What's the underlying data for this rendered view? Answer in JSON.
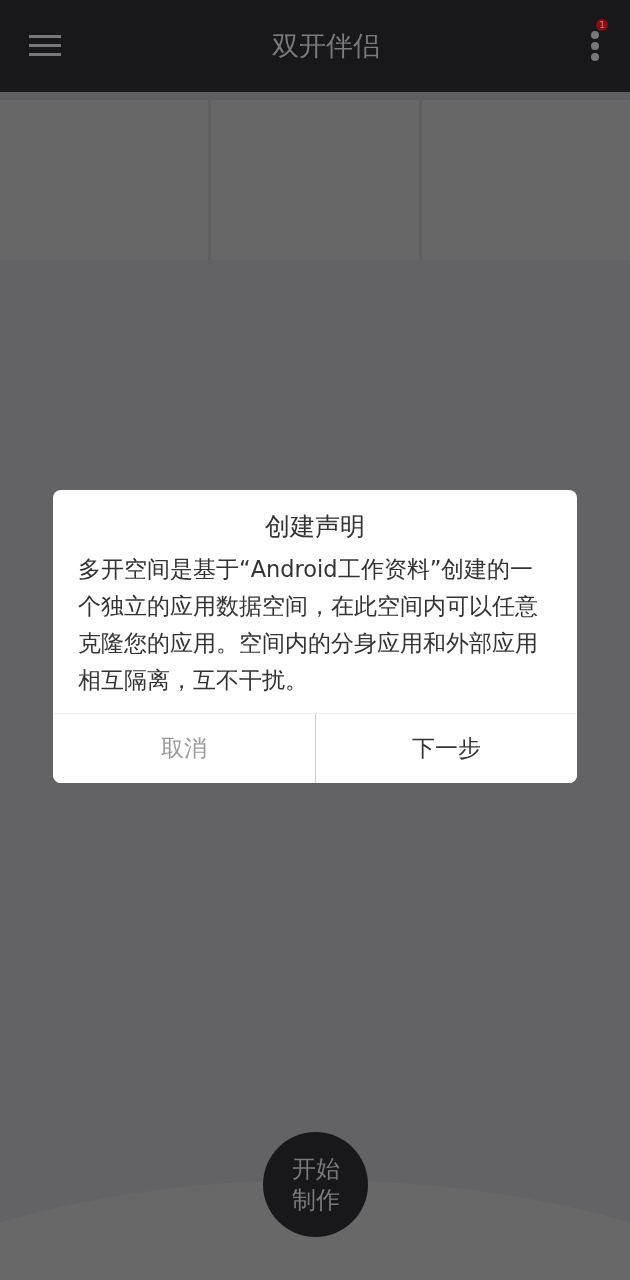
{
  "app_bar": {
    "title": "双开伴侣",
    "badge": "1"
  },
  "dialog": {
    "title": "创建声明",
    "message": "多开空间是基于“Android工作资料”创建的一个独立的应用数据空间，在此空间内可以任意克隆您的应用。空间内的分身应用和外部应用相互隔离，互不干扰。",
    "buttons": [
      {
        "label": "取消",
        "kind": "cancel"
      },
      {
        "label": "下一步",
        "kind": "confirm"
      }
    ]
  },
  "start_button": {
    "label": "开始制作"
  }
}
